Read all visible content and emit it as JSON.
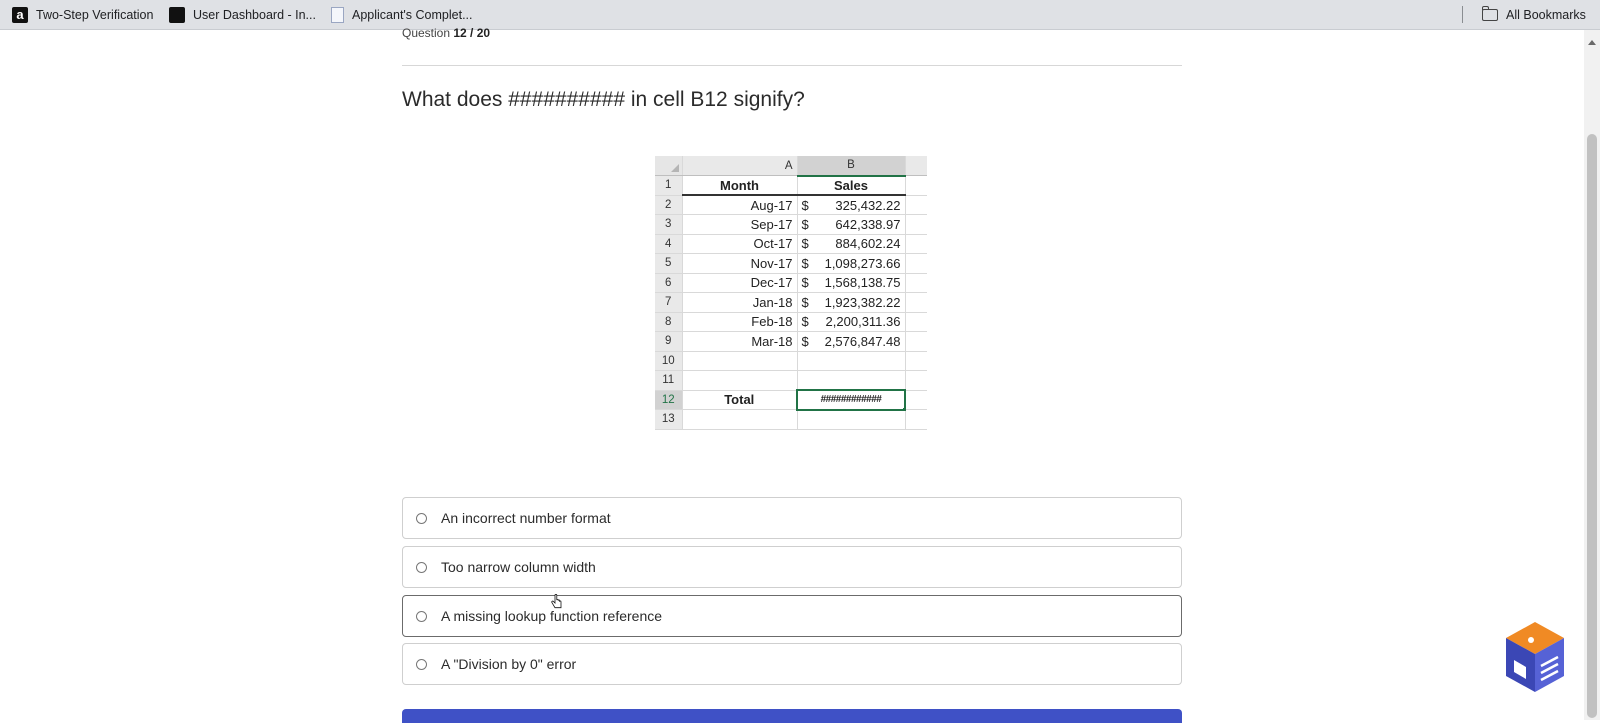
{
  "bookmarks": {
    "items": [
      {
        "label": "Two-Step Verification",
        "icon": "amazon-icon"
      },
      {
        "label": "User Dashboard - In...",
        "icon": "dashboard-icon"
      },
      {
        "label": "Applicant's Complet...",
        "icon": "document-icon"
      }
    ],
    "all_bookmarks": "All Bookmarks"
  },
  "quiz": {
    "counter_label": "Question",
    "counter_value": "12 / 20",
    "question": "What does ########## in cell B12 signify?",
    "options": [
      {
        "label": "An incorrect number format"
      },
      {
        "label": "Too narrow column width"
      },
      {
        "label": "A missing lookup function reference"
      },
      {
        "label": "A \"Division by 0\" error"
      }
    ]
  },
  "sheet": {
    "col_headers": [
      "A",
      "B"
    ],
    "header_row": {
      "month": "Month",
      "sales": "Sales"
    },
    "rows": [
      {
        "n": "2",
        "month": "Aug-17",
        "cur": "$",
        "amt": "325,432.22"
      },
      {
        "n": "3",
        "month": "Sep-17",
        "cur": "$",
        "amt": "642,338.97"
      },
      {
        "n": "4",
        "month": "Oct-17",
        "cur": "$",
        "amt": "884,602.24"
      },
      {
        "n": "5",
        "month": "Nov-17",
        "cur": "$",
        "amt": "1,098,273.66"
      },
      {
        "n": "6",
        "month": "Dec-17",
        "cur": "$",
        "amt": "1,568,138.75"
      },
      {
        "n": "7",
        "month": "Jan-18",
        "cur": "$",
        "amt": "1,923,382.22"
      },
      {
        "n": "8",
        "month": "Feb-18",
        "cur": "$",
        "amt": "2,200,311.36"
      },
      {
        "n": "9",
        "month": "Mar-18",
        "cur": "$",
        "amt": "2,576,847.48"
      }
    ],
    "empty_rows": [
      "10",
      "11"
    ],
    "total_row": {
      "n": "12",
      "label": "Total",
      "value": "############"
    },
    "last_row": "13"
  },
  "colors": {
    "accent": "#3f51c6",
    "excel_green": "#217346"
  }
}
